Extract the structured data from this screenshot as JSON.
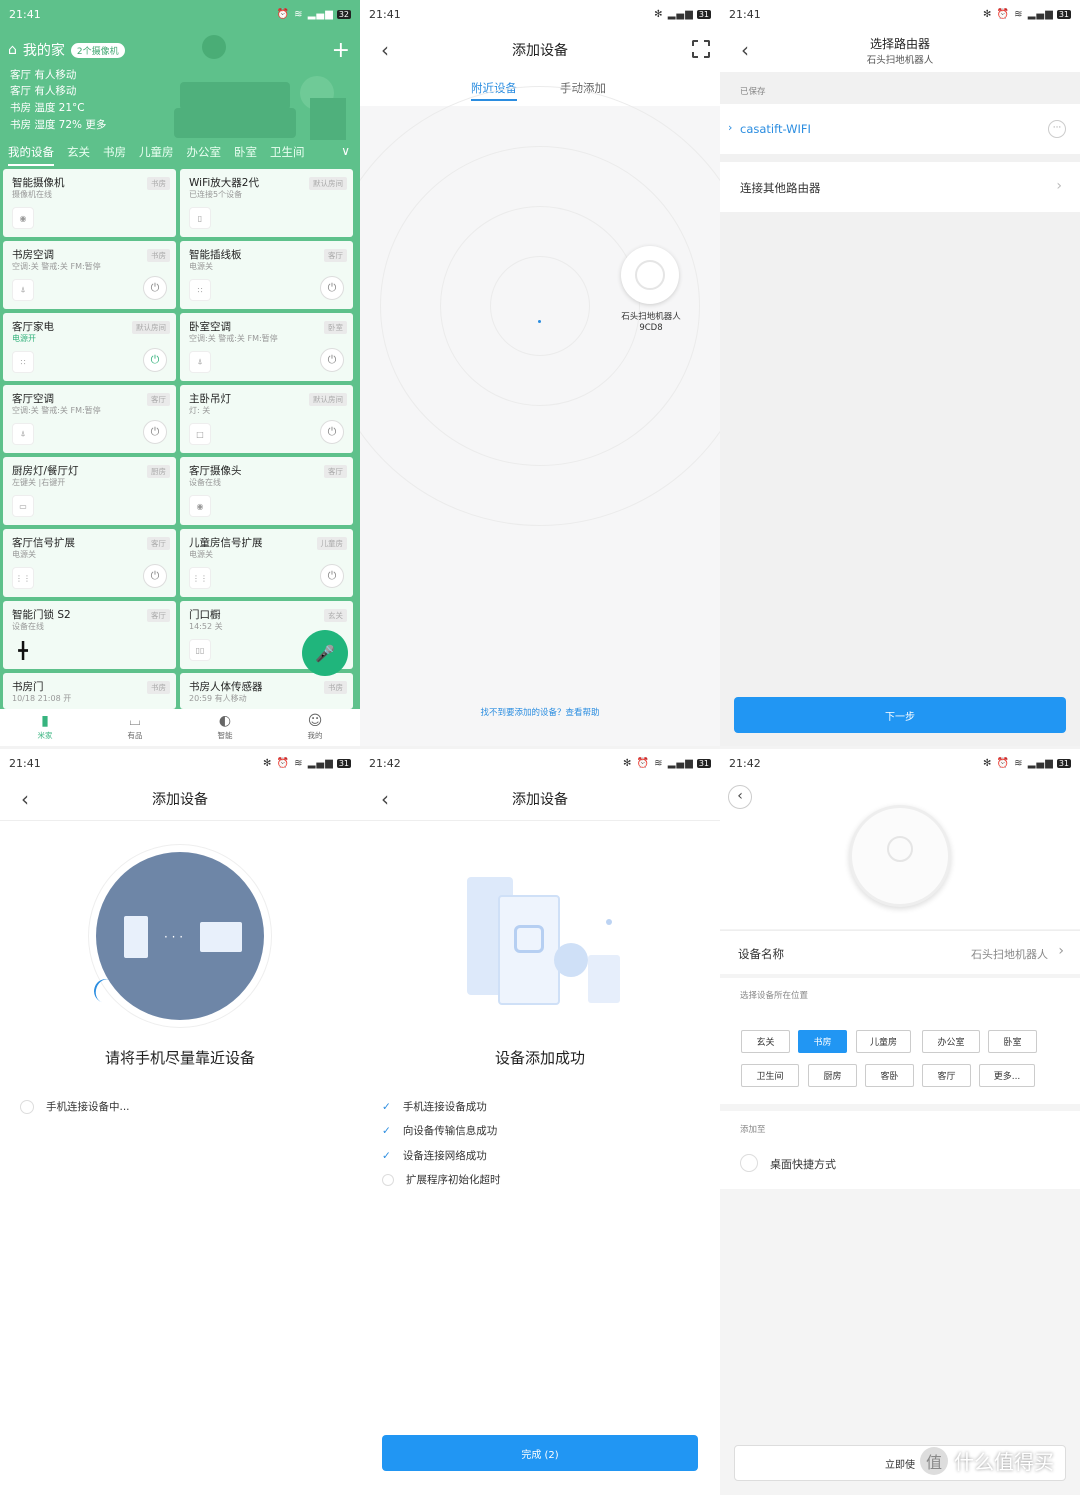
{
  "p1": {
    "time": "21:41",
    "battery": "32",
    "home_title": "我的家",
    "camera_badge": "2个摄像机",
    "plus": "+",
    "stats": [
      "客厅 有人移动",
      "客厅 有人移动",
      "书房 温度 21°C",
      "书房 湿度 72%  更多"
    ],
    "tabs": [
      "我的设备",
      "玄关",
      "书房",
      "儿童房",
      "办公室",
      "卧室",
      "卫生间"
    ],
    "cards": [
      {
        "name": "智能摄像机",
        "status": "摄像机在线",
        "room": "书房",
        "power": false
      },
      {
        "name": "WiFi放大器2代",
        "status": "已连接5个设备",
        "room": "默认房间",
        "power": false
      },
      {
        "name": "书房空调",
        "status": "空调:关 警戒:关 FM:暂停",
        "room": "书房",
        "power": true
      },
      {
        "name": "智能插线板",
        "status": "电源关",
        "room": "客厅",
        "power": true
      },
      {
        "name": "客厅家电",
        "status": "电源开",
        "room": "默认房间",
        "power": true
      },
      {
        "name": "卧室空调",
        "status": "空调:关 警戒:关 FM:暂停",
        "room": "卧室",
        "power": true
      },
      {
        "name": "客厅空调",
        "status": "空调:关 警戒:关 FM:暂停",
        "room": "客厅",
        "power": true
      },
      {
        "name": "主卧吊灯",
        "status": "灯: 关",
        "room": "默认房间",
        "power": true
      },
      {
        "name": "厨房灯/餐厅灯",
        "status": "左键关 |右键开",
        "room": "厨房",
        "power": false
      },
      {
        "name": "客厅摄像头",
        "status": "设备在线",
        "room": "客厅",
        "power": false
      },
      {
        "name": "客厅信号扩展",
        "status": "电源关",
        "room": "客厅",
        "power": true
      },
      {
        "name": "儿童房信号扩展",
        "status": "电源关",
        "room": "儿童房",
        "power": true
      },
      {
        "name": "智能门锁 S2",
        "status": "设备在线",
        "room": "客厅",
        "power": false
      },
      {
        "name": "门口橱",
        "status": "14:52 关",
        "room": "玄关",
        "power": false
      },
      {
        "name": "书房门",
        "status": "10/18 21:08 开",
        "room": "书房",
        "power": false
      },
      {
        "name": "书房人体传感器",
        "status": "20:59 有人移动",
        "room": "书房",
        "power": false
      }
    ],
    "nav": [
      "米家",
      "有品",
      "智能",
      "我的"
    ]
  },
  "p2": {
    "time": "21:41",
    "battery": "31",
    "title": "添加设备",
    "tab_nearby": "附近设备",
    "tab_manual": "手动添加",
    "device_label": "石头扫地机器人9CD8",
    "help": "找不到要添加的设备？查看帮助"
  },
  "p3": {
    "time": "21:41",
    "battery": "31",
    "title": "选择路由器",
    "subtitle": "石头扫地机器人",
    "saved_label": "已保存",
    "wifi_name": "casatift-WIFI",
    "other_router": "连接其他路由器",
    "next": "下一步"
  },
  "p4": {
    "time": "21:41",
    "battery": "31",
    "title": "添加设备",
    "heading": "请将手机尽量靠近设备",
    "step": "手机连接设备中..."
  },
  "p5": {
    "time": "21:42",
    "battery": "31",
    "title": "添加设备",
    "heading": "设备添加成功",
    "steps": [
      "手机连接设备成功",
      "向设备传输信息成功",
      "设备连接网络成功",
      "扩展程序初始化超时"
    ],
    "done": "完成 (2)"
  },
  "p6": {
    "time": "21:42",
    "battery": "31",
    "device_name_label": "设备名称",
    "device_name_value": "石头扫地机器人",
    "location_label": "选择设备所在位置",
    "rooms": [
      "玄关",
      "书房",
      "儿童房",
      "办公室",
      "卧室",
      "卫生间",
      "厨房",
      "客卧",
      "客厅",
      "更多..."
    ],
    "add_to_label": "添加至",
    "shortcut": "桌面快捷方式",
    "use_now": "立即使"
  },
  "watermark": "什么值得买",
  "colors": {
    "green": "#5ec18b",
    "blue": "#2196f3",
    "mi_blue": "#2b8de0"
  }
}
